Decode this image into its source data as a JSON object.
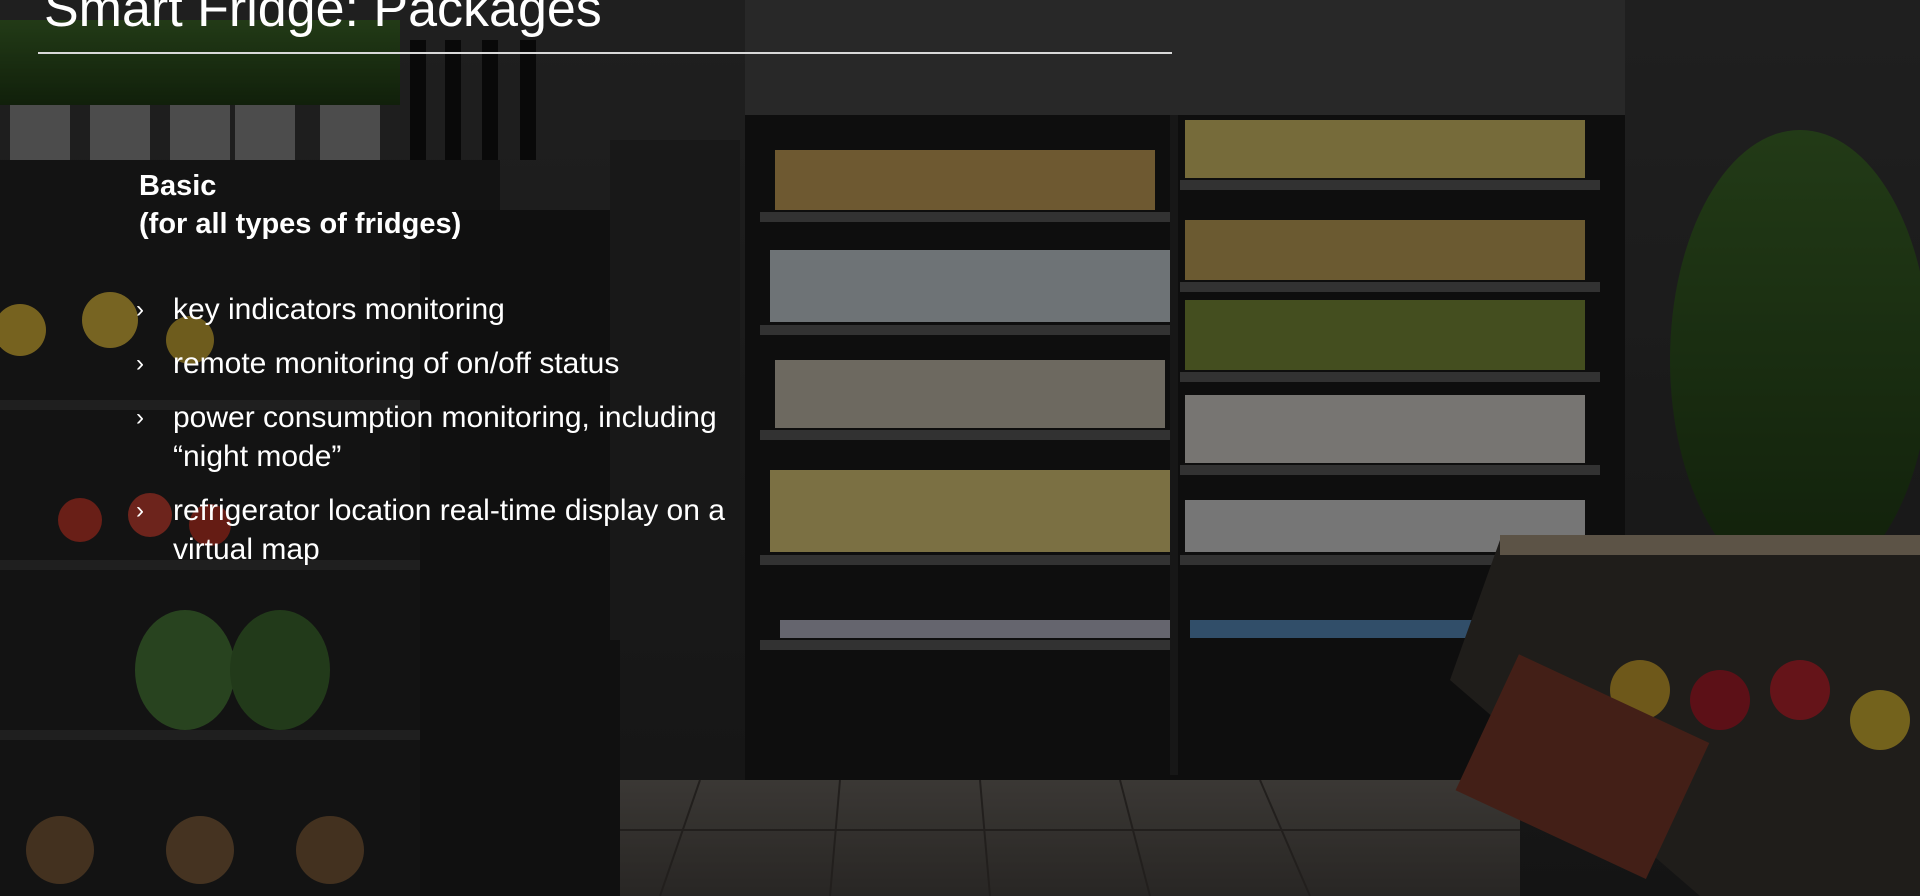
{
  "slide": {
    "title": "Smart Fridge: Packages",
    "package": {
      "name": "Basic",
      "subtitle": "(for all types of fridges)"
    },
    "bullet_marker": "›",
    "features": [
      "key indicators monitoring",
      "remote monitoring of on/off status",
      "power consumption monitoring, including “night mode”",
      "refrigerator location real-time display on a virtual map"
    ]
  },
  "colors": {
    "text": "#ffffff",
    "rule": "#d9d9d9",
    "overlay": "rgba(0,0,0,0.45)"
  },
  "background": {
    "description_icon": "store-shelves-photo"
  }
}
